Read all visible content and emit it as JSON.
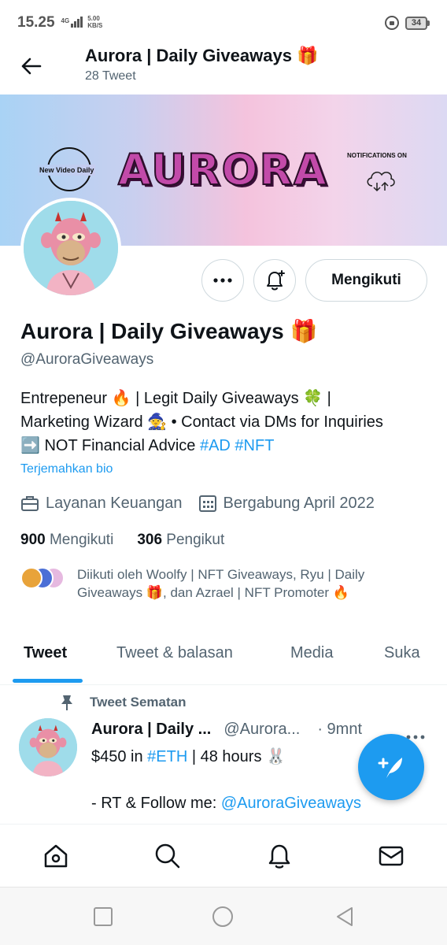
{
  "status_bar": {
    "time": "15.25",
    "network": "4G",
    "speed_value": "5.00",
    "speed_unit": "KB/S",
    "battery": "34"
  },
  "header": {
    "title": "Aurora | Daily Giveaways 🎁",
    "subtitle": "28 Tweet"
  },
  "banner": {
    "left_text": "New Video Daily",
    "logo_text": "AURORA",
    "right_text": "NOTIFICATIONS ON"
  },
  "actions": {
    "follow_label": "Mengikuti"
  },
  "profile": {
    "name": "Aurora | Daily Giveaways 🎁",
    "handle": "@AuroraGiveaways",
    "bio_line1": "Entrepeneur 🔥 | Legit Daily Giveaways  🍀 |",
    "bio_line2": "Marketing Wizard 🧙 • Contact via DMs for Inquiries",
    "bio_line3_text": "➡️ NOT Financial Advice ",
    "bio_tag1": "#AD",
    "bio_tag2": "#NFT",
    "translate_label": "Terjemahkan bio",
    "category": "Layanan Keuangan",
    "joined": "Bergabung April 2022",
    "following_count": "900",
    "following_label": "Mengikuti",
    "followers_count": "306",
    "followers_label": "Pengikut",
    "followed_by": "Diikuti oleh Woolfy | NFT Giveaways, Ryu | Daily Giveaways 🎁, dan Azrael | NFT Promoter 🔥"
  },
  "tabs": [
    {
      "label": "Tweet"
    },
    {
      "label": "Tweet & balasan"
    },
    {
      "label": "Media"
    },
    {
      "label": "Suka"
    }
  ],
  "tweet": {
    "pinned_label": "Tweet Sematan",
    "name": "Aurora | Daily ...",
    "handle": "@Aurora...",
    "time": "· 9mnt",
    "line1_pre": "$450 in ",
    "line1_tag": "#ETH",
    "line1_post": " | 48 hours 🐰",
    "line2_pre": "- RT & Follow me: ",
    "line2_mention": "@AuroraGiveaways"
  },
  "colors": {
    "accent": "#1d9bf0",
    "text_primary": "#0f1419",
    "text_secondary": "#536471"
  }
}
